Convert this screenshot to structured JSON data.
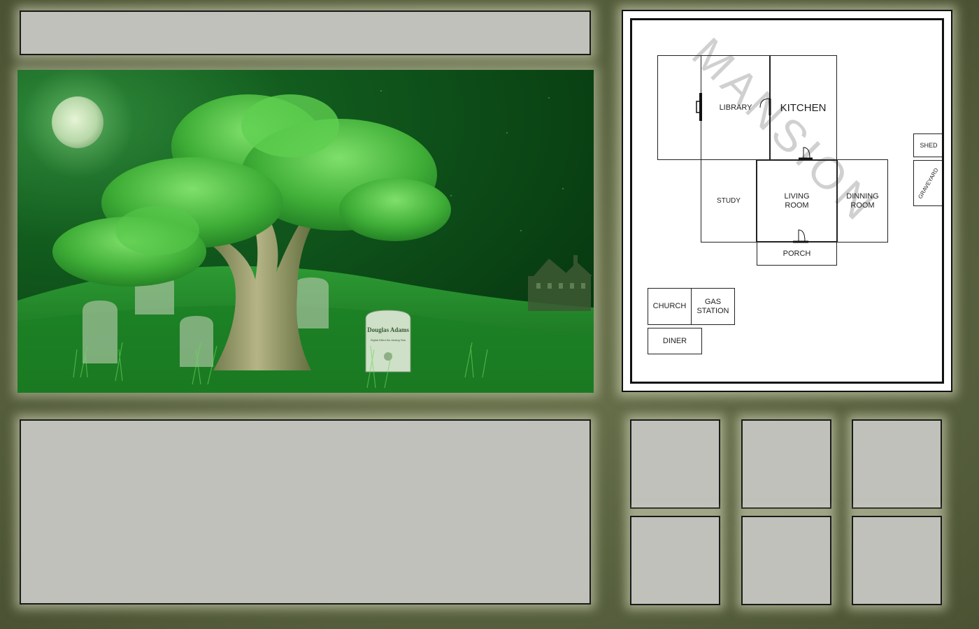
{
  "title_bar": {
    "text": ""
  },
  "scene": {
    "tombstone_name": "Douglas Adams",
    "tombstone_epitaph": "Digital Killed the Analog Star"
  },
  "map": {
    "watermark": "MANSION",
    "rooms": {
      "library": "LIBRARY",
      "kitchen": "KITCHEN",
      "study": "STUDY",
      "living_room": "LIVING\nROOM",
      "dinning_room": "DINNING\nROOM",
      "porch": "PORCH",
      "shed": "SHED",
      "graveyard": "GRAVEYARD",
      "church": "CHURCH",
      "gas_station": "GAS\nSTATION",
      "diner": "DINER"
    }
  },
  "text_box": {
    "text": ""
  },
  "colors": {
    "frame_bg": "#5a6340",
    "panel_bg": "#c0c1bb",
    "scene_green": "#1a7a22",
    "sky_dark": "#0a3a12"
  }
}
